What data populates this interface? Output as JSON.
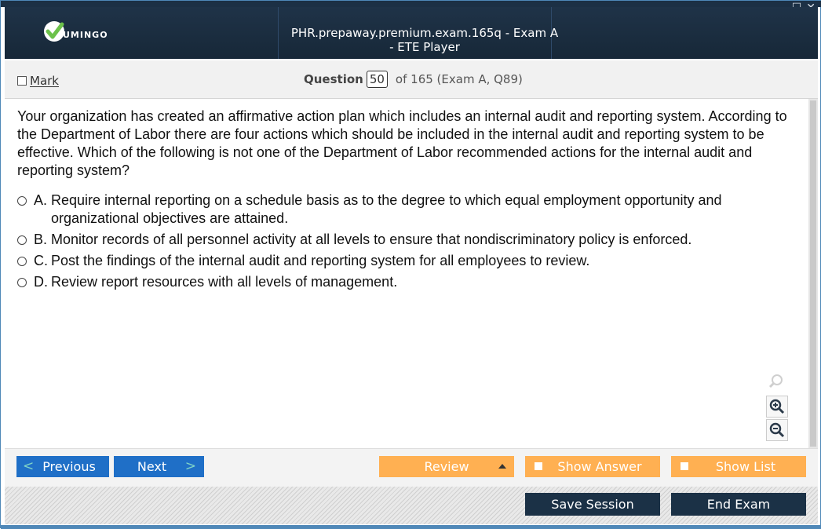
{
  "header": {
    "logo_text": "UMINGO",
    "window_title": "PHR.prepaway.premium.exam.165q - Exam A - ETE Player",
    "controls": [
      "_",
      "☐",
      "✕"
    ]
  },
  "question_bar": {
    "mark_label": "Mark",
    "question_label": "Question",
    "question_number": "50",
    "of_text": "of 165 (Exam A, Q89)"
  },
  "question": {
    "text": "Your organization has created an affirmative action plan which includes an internal audit and reporting system. According to the Department of Labor there are four actions which should be included in the internal audit and reporting system to be effective. Which of the following is not one of the Department of Labor recommended actions for the internal audit and reporting system?",
    "options": [
      {
        "letter": "A.",
        "text": "Require internal reporting on a schedule basis as to the degree to which equal employment opportunity and organizational objectives are attained."
      },
      {
        "letter": "B.",
        "text": "Monitor records of all personnel activity at all levels to ensure that nondiscriminatory policy is enforced."
      },
      {
        "letter": "C.",
        "text": "Post the findings of the internal audit and reporting system for all employees to review."
      },
      {
        "letter": "D.",
        "text": "Review report resources with all levels of management."
      }
    ]
  },
  "zoom": {
    "icons": [
      "search-icon",
      "zoom-in-icon",
      "zoom-out-icon"
    ]
  },
  "nav": {
    "previous_label": "Previous",
    "next_label": "Next",
    "review_label": "Review",
    "show_answer_label": "Show Answer",
    "show_list_label": "Show List",
    "save_session_label": "Save Session",
    "end_exam_label": "End Exam"
  },
  "colors": {
    "header_bg": "#1f3348",
    "nav_blue": "#1f6fc7",
    "orange": "#ffb052",
    "dark_button": "#1b3146",
    "logo_green": "#6cc24a"
  }
}
